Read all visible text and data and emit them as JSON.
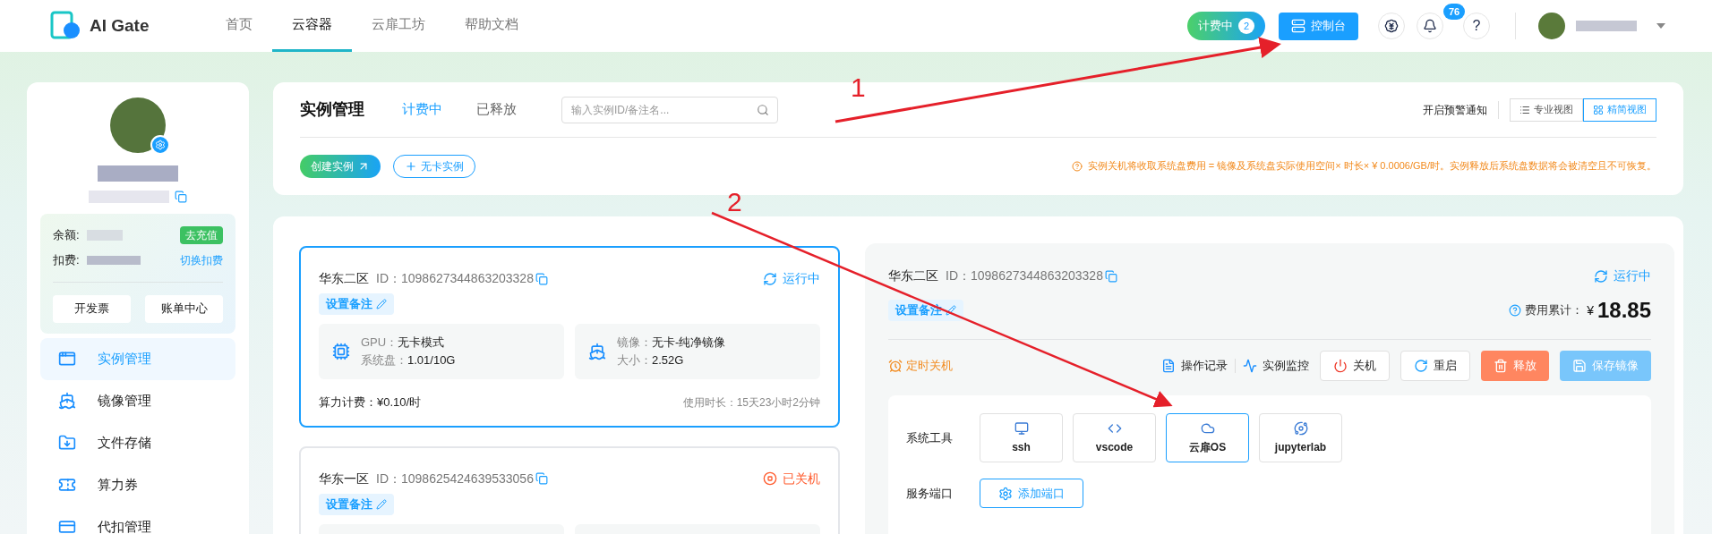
{
  "header": {
    "logo_text": "AI Gate",
    "nav": [
      {
        "label": "首页",
        "selected": false
      },
      {
        "label": "云容器",
        "selected": true
      },
      {
        "label": "云扉工坊",
        "selected": false
      },
      {
        "label": "帮助文档",
        "selected": false
      }
    ],
    "billing_badge": {
      "label": "计费中",
      "count": "2"
    },
    "console_button": "控制台",
    "notification_count": "76",
    "help": "?"
  },
  "sidebar": {
    "balance_label": "余额:",
    "recharge_button": "去充值",
    "deduct_label": "扣费:",
    "switch_link": "切换扣费",
    "buttons": [
      "开发票",
      "账单中心"
    ],
    "menu": [
      {
        "label": "实例管理",
        "selected": true,
        "kind": "instances"
      },
      {
        "label": "镜像管理",
        "selected": false,
        "kind": "images"
      },
      {
        "label": "文件存储",
        "selected": false,
        "kind": "storage"
      },
      {
        "label": "算力券",
        "selected": false,
        "kind": "voucher"
      },
      {
        "label": "代扣管理",
        "selected": false,
        "kind": "deduct"
      }
    ]
  },
  "toolbar": {
    "title": "实例管理",
    "tabs": [
      {
        "label": "计费中",
        "selected": true
      },
      {
        "label": "已释放",
        "selected": false
      }
    ],
    "search_placeholder": "输入实例ID/备注名...",
    "alert_toggle": "开启预警通知",
    "views": [
      {
        "label": "专业视图",
        "selected": false,
        "kind": "list"
      },
      {
        "label": "精简视图",
        "selected": true,
        "kind": "grid"
      }
    ],
    "create_button": "创建实例",
    "no_gpu_button": "无卡实例",
    "notice": "实例关机将收取系统盘费用 = 镜像及系统盘实际使用空间× 时长× ¥ 0.0006/GB/时。实例释放后系统盘数据将会被清空且不可恢复。"
  },
  "instances": [
    {
      "region": "华东二区",
      "id_label": "ID：",
      "id": "1098627344863203328",
      "status": "运行中",
      "running": true,
      "selected": true,
      "note_button": "设置备注",
      "gpu_label": "GPU：",
      "gpu_value": "无卡模式",
      "disk_label": "系统盘：",
      "disk_value": "1.01/10G",
      "image_label": "镜像：",
      "image_value": "无卡-纯净镜像",
      "size_label": "大小：",
      "size_value": "2.52G",
      "price_label": "算力计费：",
      "price_value": "¥0.10/时",
      "duration": "使用时长：15天23小时2分钟"
    },
    {
      "region": "华东一区",
      "id_label": "ID：",
      "id": "1098625424639533056",
      "status": "已关机",
      "running": false,
      "selected": false,
      "note_button": "设置备注"
    }
  ],
  "detail": {
    "region": "华东二区",
    "id_label": "ID：",
    "id": "1098627344863203328",
    "status": "运行中",
    "running": true,
    "note_button": "设置备注",
    "cost_label": "费用累计：",
    "currency": "¥",
    "cost": "18.85",
    "schedule": "定时关机",
    "links": [
      "操作记录",
      "实例监控"
    ],
    "actions": [
      {
        "label": "关机",
        "kind": "power"
      },
      {
        "label": "重启",
        "kind": "restart"
      },
      {
        "label": "释放",
        "kind": "release"
      },
      {
        "label": "保存镜像",
        "kind": "save"
      }
    ],
    "tools_label": "系统工具",
    "tools": [
      {
        "label": "ssh",
        "selected": false,
        "kind": "ssh"
      },
      {
        "label": "vscode",
        "selected": false,
        "kind": "vscode"
      },
      {
        "label": "云扉OS",
        "selected": true,
        "kind": "os"
      },
      {
        "label": "jupyterlab",
        "selected": false,
        "kind": "jupyter"
      }
    ],
    "ports_label": "服务端口",
    "add_port_button": "添加端口"
  },
  "annotations": [
    {
      "label": "1"
    },
    {
      "label": "2"
    }
  ]
}
